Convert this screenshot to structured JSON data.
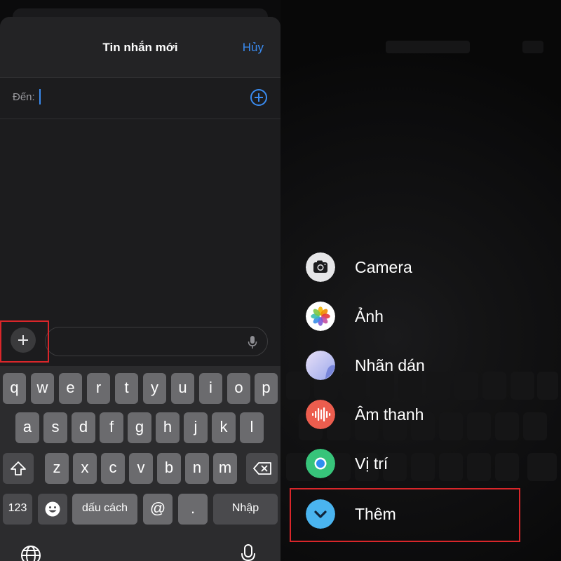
{
  "left_panel": {
    "header": {
      "title": "Tin nhắn mới",
      "cancel_label": "Hủy"
    },
    "to_field": {
      "label": "Đến:",
      "value": ""
    },
    "compose": {
      "plus_icon": "plus-icon",
      "mic_icon": "mic-icon"
    },
    "keyboard": {
      "row1": [
        "q",
        "w",
        "e",
        "r",
        "t",
        "y",
        "u",
        "i",
        "o",
        "p"
      ],
      "row2": [
        "a",
        "s",
        "d",
        "f",
        "g",
        "h",
        "j",
        "k",
        "l"
      ],
      "row3": [
        "z",
        "x",
        "c",
        "v",
        "b",
        "n",
        "m"
      ],
      "shift_icon": "shift-icon",
      "delete_icon": "backspace-icon",
      "numbers_label": "123",
      "emoji_icon": "emoji-icon",
      "space_label": "dấu cách",
      "at_label": "@",
      "dot_label": ".",
      "return_label": "Nhập",
      "globe_icon": "globe-icon",
      "dictation_icon": "mic-icon"
    },
    "highlight_color": "#d9262a",
    "accent_color": "#3a8bf0"
  },
  "right_panel": {
    "menu": [
      {
        "label": "Camera",
        "icon": "camera-icon"
      },
      {
        "label": "Ảnh",
        "icon": "photos-icon"
      },
      {
        "label": "Nhãn dán",
        "icon": "stickers-icon"
      },
      {
        "label": "Âm thanh",
        "icon": "audio-icon"
      },
      {
        "label": "Vị trí",
        "icon": "location-icon"
      },
      {
        "label": "Thêm",
        "icon": "chevron-down-icon"
      }
    ],
    "highlight_color": "#d9262a"
  }
}
